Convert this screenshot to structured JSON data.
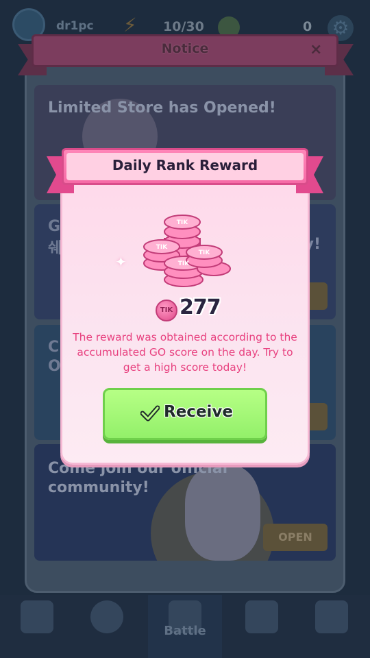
{
  "hud": {
    "player_name": "dr1pc",
    "energy": "10/30",
    "coins": "0",
    "icons": {
      "energy": "lightning-icon",
      "coin": "coin-icon",
      "settings": "gear-icon"
    }
  },
  "notice": {
    "title": "Notice",
    "close": "×",
    "cards": [
      {
        "title": "Limited Store has Opened!"
      },
      {
        "fragment_left": "G",
        "fragment_left_2": "쉐",
        "fragment_right": "y!"
      },
      {
        "fragment_left": "C",
        "fragment_left_2": "O"
      },
      {
        "title": "Come join our official community!",
        "button": "OPEN"
      }
    ]
  },
  "bottom_nav": {
    "battle_label": "Battle"
  },
  "modal": {
    "title": "Daily Rank Reward",
    "currency_badge": "TIK",
    "amount": "277",
    "description": "The reward was obtained according to the accumulated GO score on the day. Try to get a high score today!",
    "receive_label": "Receive",
    "colors": {
      "accent": "#e8417f",
      "button": "#9cf26f",
      "header": "#f66ba6"
    }
  }
}
